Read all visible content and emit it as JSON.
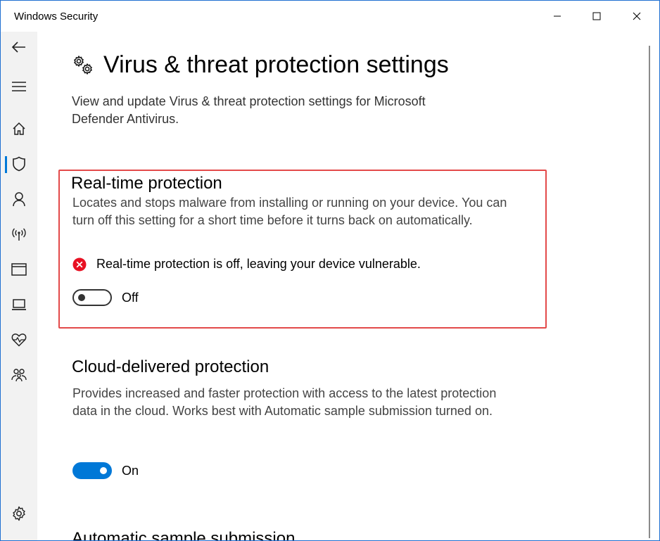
{
  "window": {
    "title": "Windows Security"
  },
  "nav": {
    "items": [
      {
        "icon": "back-arrow-icon"
      },
      {
        "icon": "hamburger-menu-icon"
      },
      {
        "icon": "home-icon"
      },
      {
        "icon": "shield-icon",
        "selected": true
      },
      {
        "icon": "person-icon"
      },
      {
        "icon": "network-antenna-icon"
      },
      {
        "icon": "browser-window-icon"
      },
      {
        "icon": "laptop-icon"
      },
      {
        "icon": "heart-pulse-icon"
      },
      {
        "icon": "family-icon"
      },
      {
        "icon": "gear-icon"
      }
    ],
    "accent": "#0078d7"
  },
  "page": {
    "title": "Virus & threat protection settings",
    "description": "View and update Virus & threat protection settings for Microsoft Defender Antivirus."
  },
  "sections": {
    "realtime": {
      "title": "Real-time protection",
      "description": "Locates and stops malware from installing or running on your device. You can turn off this setting for a short time before it turns back on automatically.",
      "status": "Real-time protection is off, leaving your device vulnerable.",
      "toggle_state": "Off",
      "highlight_color": "#e34a4a",
      "status_color": "#e81123"
    },
    "cloud": {
      "title": "Cloud-delivered protection",
      "description": "Provides increased and faster protection with access to the latest protection data in the cloud. Works best with Automatic sample submission turned on.",
      "toggle_state": "On"
    },
    "sample": {
      "title": "Automatic sample submission"
    }
  }
}
